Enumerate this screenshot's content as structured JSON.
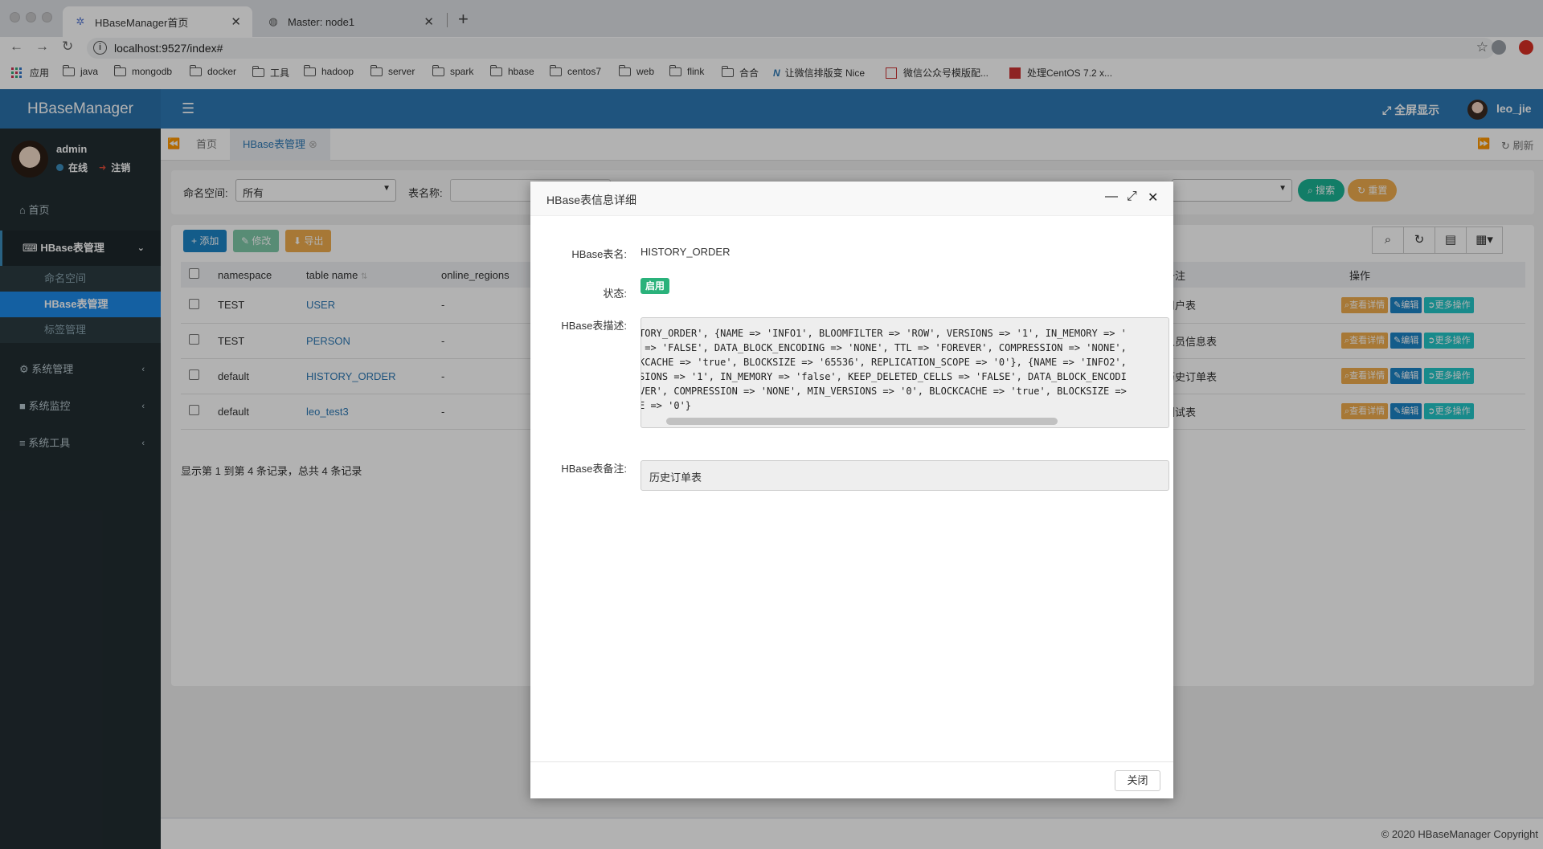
{
  "browser": {
    "tabs": [
      {
        "title": "HBaseManager首页",
        "active": true
      },
      {
        "title": "Master: node1",
        "active": false
      }
    ],
    "url": "localhost:9527/index#",
    "bookmarks": [
      "应用",
      "java",
      "mongodb",
      "docker",
      "工具",
      "hadoop",
      "server",
      "spark",
      "hbase",
      "centos7",
      "web",
      "flink",
      "合合",
      "让微信排版变 Nice",
      "微信公众号模版配...",
      "处理CentOS 7.2 x..."
    ]
  },
  "header": {
    "brand": "HBaseManager",
    "fullscreen_label": "全屏显示",
    "user": "leo_jie"
  },
  "sidebar": {
    "user_name": "admin",
    "status_online": "在线",
    "logout": "注销",
    "menu": [
      {
        "label": "首页"
      },
      {
        "label": "HBase表管理"
      },
      {
        "label": "系统管理"
      },
      {
        "label": "系统监控"
      },
      {
        "label": "系统工具"
      }
    ],
    "submenu": [
      "命名空间",
      "HBase表管理",
      "标签管理"
    ]
  },
  "tabsbar": {
    "tabs": [
      "首页",
      "HBase表管理"
    ],
    "refresh": "刷新"
  },
  "search": {
    "namespace_label": "命名空间:",
    "namespace_value": "所有",
    "tablename_label": "表名称:",
    "search_btn": "搜索",
    "reset_btn": "重置"
  },
  "toolbar": {
    "add": "添加",
    "edit": "修改",
    "export": "导出"
  },
  "table": {
    "columns": [
      "namespace",
      "table name",
      "online_regions",
      "备注",
      "操作"
    ],
    "rows": [
      {
        "namespace": "TEST",
        "name": "USER",
        "regions": "-",
        "remark": "用户表"
      },
      {
        "namespace": "TEST",
        "name": "PERSON",
        "regions": "-",
        "remark": "人员信息表"
      },
      {
        "namespace": "default",
        "name": "HISTORY_ORDER",
        "regions": "-",
        "remark": "历史订单表"
      },
      {
        "namespace": "default",
        "name": "leo_test3",
        "regions": "-",
        "remark": "测试表"
      }
    ],
    "ops": [
      "查看详情",
      "编辑",
      "更多操作"
    ],
    "pagination": "显示第 1 到第 4 条记录，总共 4 条记录"
  },
  "footer": "© 2020 HBaseManager Copyright",
  "modal": {
    "title": "HBase表信息详细",
    "name_label": "HBase表名:",
    "name_value": "HISTORY_ORDER",
    "status_label": "状态:",
    "status_value": "启用",
    "desc_label": "HBase表描述:",
    "desc_lines": [
      "TORY_ORDER', {NAME => 'INFO1', BLOOMFILTER => 'ROW', VERSIONS => '1', IN_MEMORY => '",
      " => 'FALSE', DATA_BLOCK_ENCODING => 'NONE', TTL => 'FOREVER', COMPRESSION => 'NONE',",
      "KCACHE => 'true', BLOCKSIZE => '65536', REPLICATION_SCOPE => '0'}, {NAME => 'INFO2',",
      "SIONS => '1', IN_MEMORY => 'false', KEEP_DELETED_CELLS => 'FALSE', DATA_BLOCK_ENCODI",
      "VER', COMPRESSION => 'NONE', MIN_VERSIONS => '0', BLOCKCACHE => 'true', BLOCKSIZE =>",
      "E => '0'}"
    ],
    "remark_label": "HBase表备注:",
    "remark_value": "历史订单表",
    "close_btn": "关闭"
  },
  "colors": {
    "header_blue": "#2d79b5",
    "sidebar_dark": "#222d32",
    "submenu_selected": "#1d8ae8",
    "status_green": "#2ab27b",
    "btn_orange": "#f0ad4e",
    "btn_teal": "#1ab394"
  }
}
